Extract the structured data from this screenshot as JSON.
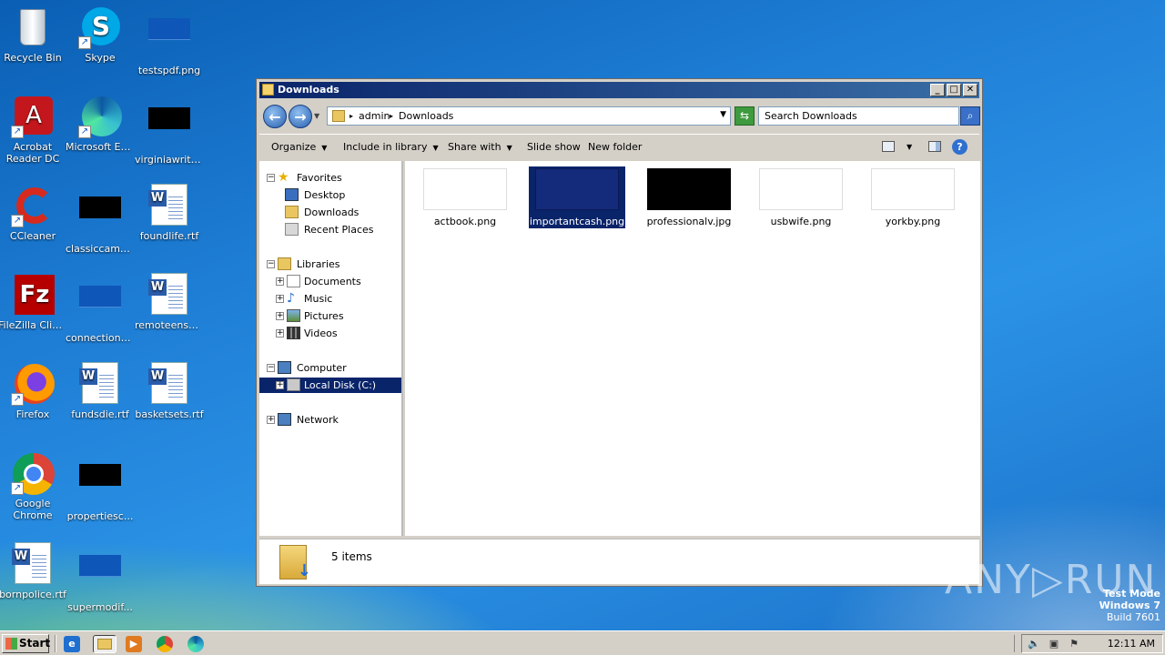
{
  "desktop": {
    "icons": [
      {
        "label": "Recycle Bin"
      },
      {
        "label": "Skype"
      },
      {
        "label": "testspdf.png"
      },
      {
        "label": "Acrobat Reader DC"
      },
      {
        "label": "Microsoft Edge"
      },
      {
        "label": "virginiawrite..."
      },
      {
        "label": "CCleaner"
      },
      {
        "label": "classiccame..."
      },
      {
        "label": "foundlife.rtf"
      },
      {
        "label": "FileZilla Client"
      },
      {
        "label": "connectionc..."
      },
      {
        "label": "remoteensu..."
      },
      {
        "label": "Firefox"
      },
      {
        "label": "fundsdie.rtf"
      },
      {
        "label": "basketsets.rtf"
      },
      {
        "label": "Google Chrome"
      },
      {
        "label": "propertiesc..."
      },
      {
        "label": "bornpolice.rtf"
      },
      {
        "label": "supermodif..."
      }
    ]
  },
  "window": {
    "title": "Downloads",
    "buttons": {
      "minimize": "_",
      "maximize": "□",
      "close": "✕"
    },
    "address": {
      "crumbs": [
        "admin",
        "Downloads"
      ]
    },
    "search": {
      "placeholder": "Search Downloads"
    },
    "commands": {
      "organize": "Organize",
      "include": "Include in library",
      "share": "Share with",
      "slideshow": "Slide show",
      "newfolder": "New folder"
    },
    "nav": {
      "favorites": "Favorites",
      "desktop": "Desktop",
      "downloads": "Downloads",
      "recent": "Recent Places",
      "libraries": "Libraries",
      "documents": "Documents",
      "music": "Music",
      "pictures": "Pictures",
      "videos": "Videos",
      "computer": "Computer",
      "localdisk": "Local Disk (C:)",
      "network": "Network"
    },
    "files": [
      {
        "name": "actbook.png"
      },
      {
        "name": "importantcash.png"
      },
      {
        "name": "professionalv.jpg"
      },
      {
        "name": "usbwife.png"
      },
      {
        "name": "yorkby.png"
      }
    ],
    "status": {
      "count": "5 items"
    }
  },
  "taskbar": {
    "start": "Start",
    "clock": "12:11 AM"
  },
  "watermark": {
    "line1": "Test Mode",
    "line2": "Windows 7",
    "line3": "Build 7601",
    "brand": "ANY▷RUN"
  },
  "colors": {
    "selection": "#0a246a",
    "titlebar_start": "#0a246a",
    "desktop": "#1f7fd6"
  }
}
